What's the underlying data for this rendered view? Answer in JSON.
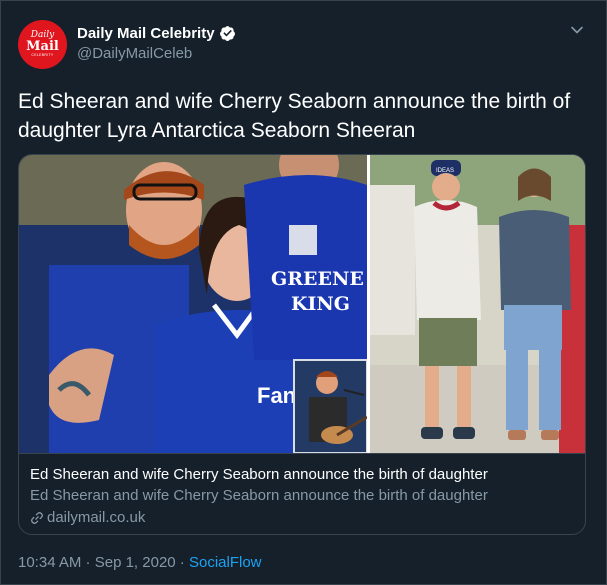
{
  "account": {
    "name": "Daily Mail Celebrity",
    "handle": "@DailyMailCeleb",
    "avatar": {
      "line1": "Daily",
      "line2": "Mail",
      "line3": "CELEBRITY"
    }
  },
  "tweet": {
    "text": "Ed Sheeran and wife Cherry Seaborn announce the birth of daughter Lyra Antarctica Seaborn Sheeran"
  },
  "card": {
    "title": "Ed Sheeran and wife Cherry Seaborn announce the birth of daughter",
    "description": "Ed Sheeran and wife Cherry Seaborn announce the birth of daughter",
    "domain": "dailymail.co.uk",
    "image_text": {
      "shirt_line1": "GREENE",
      "shirt_line2": "KING",
      "cap": "IDEAS"
    }
  },
  "meta": {
    "time": "10:34 AM",
    "sep1": " · ",
    "date": "Sep 1, 2020",
    "sep2": " · ",
    "source": "SocialFlow"
  },
  "icons": {
    "verified": "verified-badge-icon",
    "caret": "chevron-down-icon",
    "link": "link-icon"
  },
  "colors": {
    "background": "#15202b",
    "border": "#38444d",
    "secondary_text": "#8899a6",
    "link": "#1da1f2",
    "brand_red": "#e0161e"
  }
}
